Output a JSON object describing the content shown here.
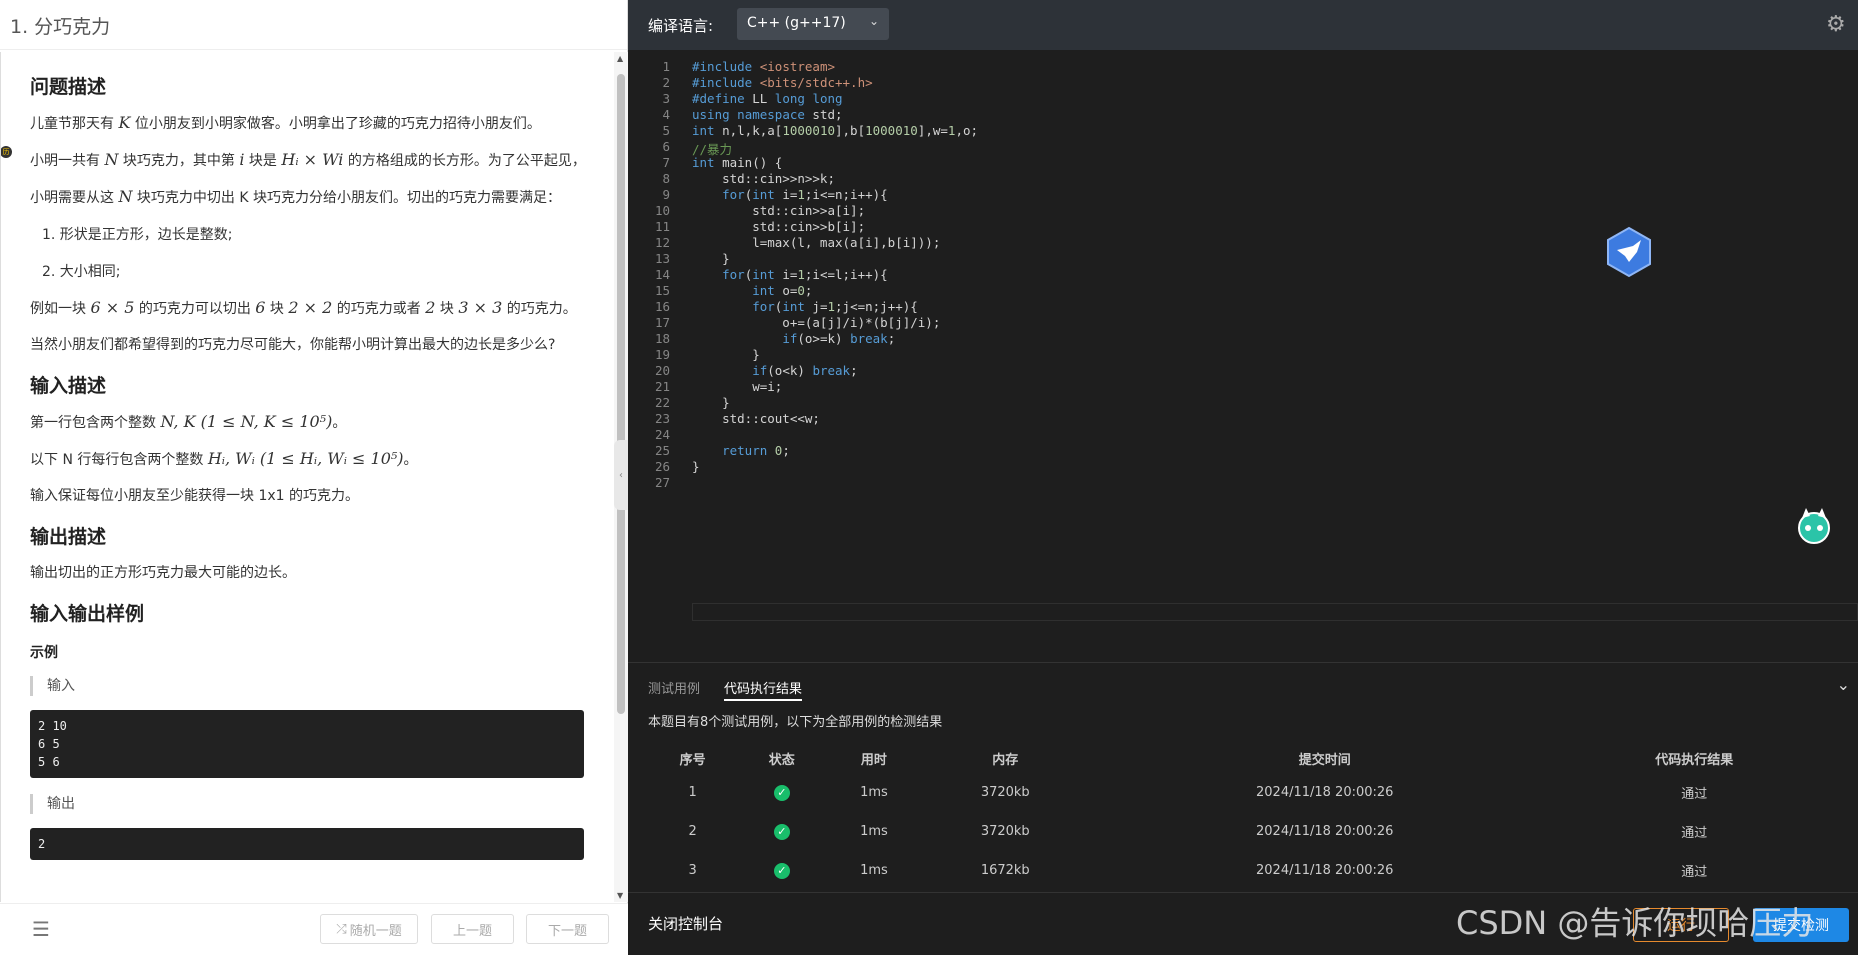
{
  "problem": {
    "title": "1. 分巧克力",
    "desc_heading": "问题描述",
    "desc_p1": [
      "儿童节那天有 ",
      "K",
      " 位小朋友到小明家做客。小明拿出了珍藏的巧克力招待小朋友们。"
    ],
    "desc_p2": [
      "小明一共有 ",
      "N",
      " 块巧克力，其中第 ",
      "i",
      " 块是 ",
      "Hᵢ × Wi",
      " 的方格组成的长方形。为了公平起见，"
    ],
    "desc_p3": [
      "小明需要从这 ",
      "N",
      " 块巧克力中切出 K 块巧克力分给小朋友们。切出的巧克力需要满足："
    ],
    "desc_list": [
      "1. 形状是正方形，边长是整数;",
      "2. 大小相同;"
    ],
    "desc_p4": [
      "例如一块 ",
      "6 × 5",
      " 的巧克力可以切出 ",
      "6",
      " 块 ",
      "2 × 2",
      " 的巧克力或者 ",
      "2",
      " 块 ",
      "3 × 3",
      " 的巧克力。"
    ],
    "desc_p5": "当然小朋友们都希望得到的巧克力尽可能大，你能帮小明计算出最大的边长是多少么?",
    "input_heading": "输入描述",
    "input_p1": [
      "第一行包含两个整数 ",
      "N, K (1 ≤ N, K ≤ 10⁵)",
      "。"
    ],
    "input_p2": [
      "以下 N 行每行包含两个整数 ",
      "Hᵢ, Wᵢ (1 ≤ Hᵢ, Wᵢ ≤ 10⁵)",
      "。"
    ],
    "input_p3": "输入保证每位小朋友至少能获得一块 1x1 的巧克力。",
    "output_heading": "输出描述",
    "output_p1": "输出切出的正方形巧克力最大可能的边长。",
    "sample_heading": "输入输出样例",
    "sample_title": "示例",
    "sample_input_label": "输入",
    "sample_input": "2 10\n6 5\n5 6",
    "sample_output_label": "输出",
    "sample_output": "2",
    "badge": "历"
  },
  "nav": {
    "list_icon": "list-icon",
    "random": "随机一题",
    "prev": "上一题",
    "next": "下一题"
  },
  "editor": {
    "lang_label": "编译语言:",
    "lang_value": "C++ (g++17)",
    "lines": [
      "#include <iostream>",
      "#include <bits/stdc++.h>",
      "#define LL long long",
      "using namespace std;",
      "int n,l,k,a[1000010],b[1000010],w=1,o;",
      "//暴力",
      "int main() {",
      "    std::cin>>n>>k;",
      "    for(int i=1;i<=n;i++){",
      "        std::cin>>a[i];",
      "        std::cin>>b[i];",
      "        l=max(l, max(a[i],b[i]));",
      "    }",
      "    for(int i=1;i<=l;i++){",
      "        int o=0;",
      "        for(int j=1;j<=n;j++){",
      "            o+=(a[j]/i)*(b[j]/i);",
      "            if(o>=k) break;",
      "        }",
      "        if(o<k) break;",
      "        w=i;",
      "    }",
      "    std::cout<<w;",
      "",
      "    return 0;",
      "}",
      ""
    ]
  },
  "console": {
    "tab_testcases": "测试用例",
    "tab_results": "代码执行结果",
    "summary": "本题目有8个测试用例，以下为全部用例的检测结果",
    "headers": [
      "序号",
      "状态",
      "用时",
      "内存",
      "提交时间",
      "代码执行结果"
    ],
    "rows": [
      {
        "id": "1",
        "time": "1ms",
        "mem": "3720kb",
        "submitted": "2024/11/18 20:00:26",
        "result": "通过"
      },
      {
        "id": "2",
        "time": "1ms",
        "mem": "3720kb",
        "submitted": "2024/11/18 20:00:26",
        "result": "通过"
      },
      {
        "id": "3",
        "time": "1ms",
        "mem": "1672kb",
        "submitted": "2024/11/18 20:00:26",
        "result": "通过"
      }
    ],
    "close_label": "关闭控制台",
    "run_label": "运行",
    "submit_label": "提交检测"
  },
  "watermark": "CSDN @告诉你坝哈压力",
  "colors": {
    "accent_blue": "#1e88e5",
    "pass_green": "#19be6b",
    "run_orange": "#e68a2e"
  }
}
